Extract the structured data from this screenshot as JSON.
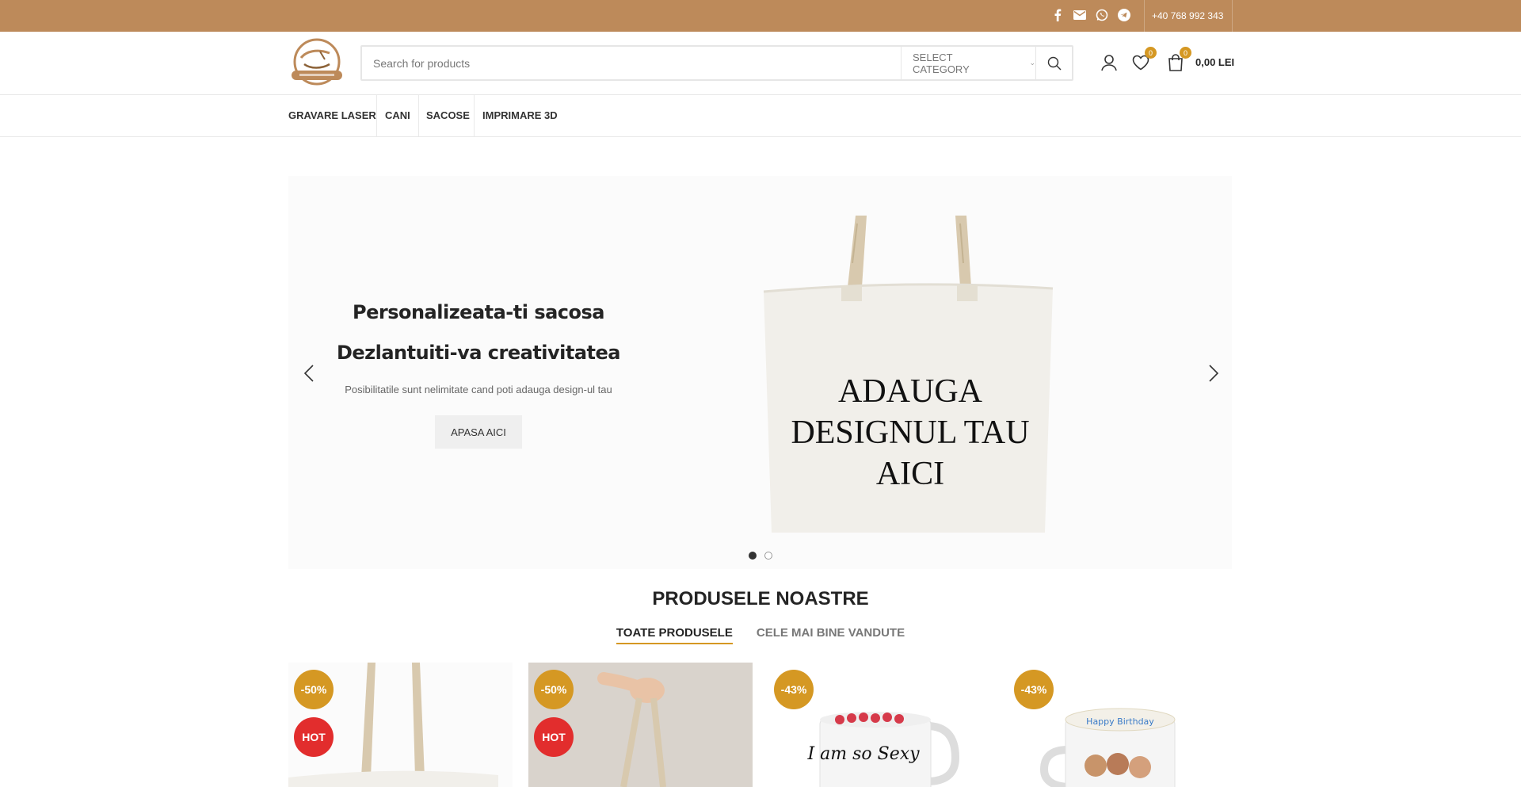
{
  "topbar": {
    "phone": "+40 768 992 343",
    "social_icons": [
      "facebook-icon",
      "email-icon",
      "whatsapp-icon",
      "telegram-icon"
    ]
  },
  "header": {
    "search_placeholder": "Search for products",
    "category_label": "SELECT CATEGORY",
    "wishlist_count": "0",
    "cart_count": "0",
    "cart_total": "0,00 LEI"
  },
  "nav": {
    "items": [
      "GRAVARE LASER",
      "CANI",
      "SACOSE",
      "IMPRIMARE 3D"
    ]
  },
  "hero": {
    "title": "Personalizeata-ti sacosa",
    "subtitle": "Dezlantuiti-va creativitatea",
    "text": "Posibilitatile sunt nelimitate cand poti adauga design-ul tau",
    "cta": "APASA AICI",
    "bag_text": [
      "ADAUGA",
      "DESIGNUL TAU",
      "AICI"
    ],
    "slides": 2,
    "active_slide": 1
  },
  "products_section": {
    "title": "PRODUSELE NOASTRE",
    "tabs": [
      "TOATE PRODUSELE",
      "CELE MAI BINE VANDUTE"
    ]
  },
  "products": [
    {
      "sale": "-50%",
      "hot": "HOT"
    },
    {
      "sale": "-50%",
      "hot": "HOT"
    },
    {
      "sale": "-43%",
      "mug_text": "I am so Sexy"
    },
    {
      "sale": "-43%",
      "mug_text": "Happy Birthday"
    }
  ],
  "colors": {
    "topbar": "#bd8a5a",
    "accent": "#d59823",
    "hot": "#e22d2d"
  }
}
